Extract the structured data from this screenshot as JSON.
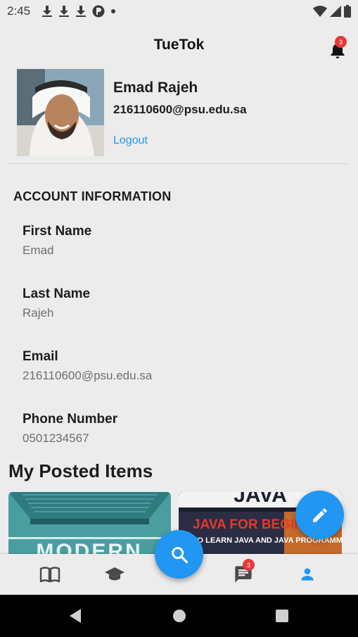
{
  "status_bar": {
    "time": "2:45"
  },
  "app_bar": {
    "title": "TueTok",
    "notification_count": "3"
  },
  "profile": {
    "name": "Emad Rajeh",
    "email": "216110600@psu.edu.sa",
    "logout_label": "Logout"
  },
  "account": {
    "section_title": "ACCOUNT INFORMATION",
    "fields": [
      {
        "label": "First Name",
        "value": "Emad"
      },
      {
        "label": "Last Name",
        "value": "Rajeh"
      },
      {
        "label": "Email",
        "value": "216110600@psu.edu.sa"
      },
      {
        "label": "Phone Number",
        "value": "0501234567"
      }
    ]
  },
  "posted": {
    "title": "My Posted Items",
    "items": [
      {
        "title_text": "MODERN"
      },
      {
        "title_text": "JAVA FOR BEGINNERS",
        "subtitle_text": "TO LEARN JAVA AND JAVA PROGRAMMING",
        "banner_text": "JAVA"
      }
    ]
  },
  "bottom_nav": {
    "items": [
      {
        "icon": "book-icon"
      },
      {
        "icon": "graduation-cap-icon"
      },
      {
        "icon": "search-icon"
      },
      {
        "icon": "chat-icon",
        "badge": "3"
      },
      {
        "icon": "account-icon",
        "active": true
      }
    ]
  },
  "colors": {
    "accent": "#2196f3",
    "background": "#ececec",
    "badge": "#e53935"
  }
}
